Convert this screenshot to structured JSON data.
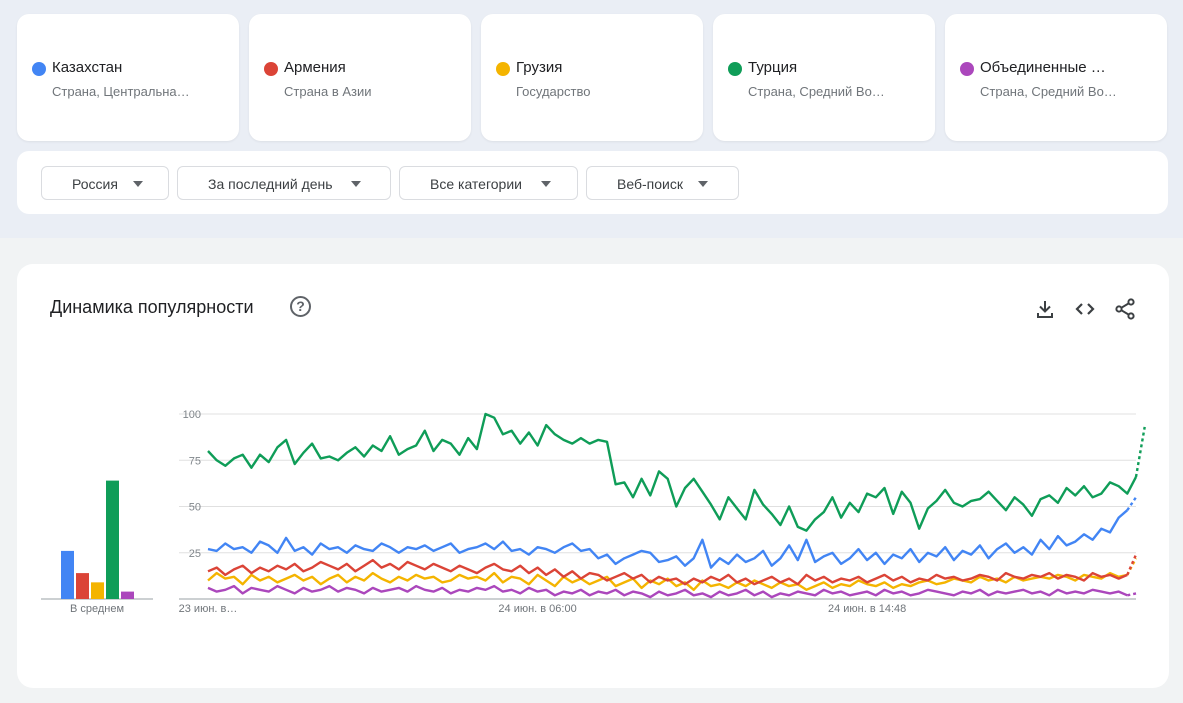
{
  "terms": [
    {
      "name": "Казахстан",
      "description": "Страна, Центральна…",
      "color": "#4285f4"
    },
    {
      "name": "Армения",
      "description": "Страна в Азии",
      "color": "#db4437"
    },
    {
      "name": "Грузия",
      "description": "Государство",
      "color": "#f4b400"
    },
    {
      "name": "Турция",
      "description": "Страна, Средний Во…",
      "color": "#0f9d58"
    },
    {
      "name": "Объединенные …",
      "description": "Страна, Средний Во…",
      "color": "#ab47bc"
    }
  ],
  "filters": {
    "region": "Россия",
    "period": "За последний день",
    "category": "Все категории",
    "search_type": "Веб-поиск"
  },
  "chart": {
    "title": "Динамика популярности",
    "help_glyph": "?",
    "tools": [
      "download-icon",
      "embed-icon",
      "share-icon"
    ]
  },
  "chart_data": {
    "type": "line",
    "title": "Динамика популярности",
    "ylim": [
      0,
      100
    ],
    "yticks": [
      100,
      75,
      50,
      25
    ],
    "grid": true,
    "legend": "top cards",
    "x_tick_labels": [
      "23 июн. в…",
      "24 июн. в 06:00",
      "24 июн. в 14:48"
    ],
    "x_tick_positions": [
      0,
      38,
      76
    ],
    "x_count": 108,
    "last_point_partial": true,
    "averages_label": "В среднем",
    "averages": [
      {
        "name": "Казахстан",
        "value": 26,
        "color": "#4285f4"
      },
      {
        "name": "Армения",
        "value": 14,
        "color": "#db4437"
      },
      {
        "name": "Грузия",
        "value": 9,
        "color": "#f4b400"
      },
      {
        "name": "Турция",
        "value": 64,
        "color": "#0f9d58"
      },
      {
        "name": "Объединенные …",
        "value": 4,
        "color": "#ab47bc"
      }
    ],
    "series": [
      {
        "name": "Турция",
        "color": "#0f9d58",
        "values": [
          80,
          75,
          72,
          76,
          78,
          71,
          78,
          74,
          82,
          86,
          73,
          79,
          84,
          76,
          77,
          75,
          79,
          82,
          77,
          83,
          80,
          88,
          78,
          81,
          83,
          91,
          80,
          86,
          84,
          78,
          87,
          81,
          100,
          98,
          89,
          91,
          84,
          90,
          83,
          94,
          89,
          86,
          84,
          87,
          84,
          86,
          85,
          62,
          63,
          55,
          65,
          56,
          69,
          65,
          50,
          60,
          65,
          58,
          51,
          43,
          55,
          49,
          43,
          59,
          51,
          46,
          40,
          50,
          39,
          37,
          43,
          47,
          55,
          44,
          52,
          47,
          57,
          55,
          60,
          46,
          58,
          52,
          38,
          49,
          53,
          59,
          52,
          50,
          53,
          54,
          58,
          53,
          48,
          55,
          51,
          45,
          54,
          56,
          52,
          60,
          56,
          61,
          55,
          57,
          63,
          61,
          57,
          66,
          93
        ]
      },
      {
        "name": "Казахстан",
        "color": "#4285f4",
        "values": [
          27,
          26,
          30,
          27,
          28,
          25,
          31,
          29,
          25,
          33,
          26,
          28,
          24,
          30,
          27,
          28,
          25,
          29,
          27,
          26,
          30,
          28,
          25,
          28,
          27,
          29,
          26,
          28,
          30,
          25,
          27,
          28,
          30,
          27,
          31,
          26,
          27,
          24,
          28,
          27,
          25,
          28,
          30,
          26,
          27,
          22,
          24,
          19,
          22,
          24,
          26,
          25,
          20,
          21,
          23,
          18,
          22,
          32,
          17,
          22,
          19,
          24,
          20,
          22,
          26,
          18,
          22,
          29,
          21,
          32,
          20,
          23,
          25,
          19,
          22,
          27,
          21,
          25,
          19,
          24,
          22,
          27,
          20,
          25,
          23,
          28,
          21,
          26,
          24,
          29,
          22,
          27,
          30,
          25,
          28,
          24,
          32,
          27,
          34,
          29,
          31,
          35,
          32,
          38,
          36,
          44,
          48,
          55
        ]
      },
      {
        "name": "Армения",
        "color": "#db4437",
        "values": [
          15,
          17,
          13,
          16,
          18,
          14,
          17,
          15,
          18,
          16,
          19,
          15,
          17,
          20,
          18,
          16,
          19,
          15,
          18,
          21,
          17,
          19,
          16,
          20,
          18,
          16,
          19,
          17,
          15,
          18,
          16,
          14,
          17,
          19,
          16,
          15,
          18,
          14,
          17,
          13,
          16,
          12,
          15,
          11,
          14,
          13,
          10,
          12,
          14,
          11,
          13,
          9,
          12,
          10,
          11,
          8,
          11,
          9,
          12,
          10,
          13,
          9,
          11,
          8,
          10,
          12,
          9,
          11,
          8,
          13,
          10,
          12,
          9,
          11,
          10,
          12,
          9,
          11,
          13,
          10,
          12,
          9,
          11,
          10,
          13,
          11,
          12,
          10,
          11,
          13,
          12,
          10,
          14,
          12,
          11,
          13,
          12,
          14,
          11,
          13,
          12,
          10,
          14,
          12,
          13,
          11,
          13,
          24
        ]
      },
      {
        "name": "Грузия",
        "color": "#f4b400",
        "values": [
          10,
          14,
          11,
          12,
          8,
          13,
          10,
          12,
          9,
          11,
          13,
          10,
          12,
          8,
          11,
          13,
          9,
          12,
          10,
          14,
          11,
          9,
          12,
          10,
          13,
          11,
          12,
          9,
          10,
          13,
          11,
          12,
          10,
          14,
          9,
          12,
          11,
          8,
          13,
          10,
          7,
          12,
          9,
          11,
          8,
          10,
          12,
          7,
          9,
          11,
          6,
          10,
          8,
          11,
          7,
          9,
          5,
          10,
          7,
          8,
          6,
          9,
          7,
          10,
          8,
          6,
          9,
          7,
          8,
          5,
          7,
          9,
          6,
          8,
          7,
          10,
          8,
          7,
          9,
          6,
          8,
          7,
          9,
          10,
          8,
          9,
          11,
          10,
          9,
          12,
          10,
          11,
          9,
          12,
          10,
          11,
          12,
          11,
          13,
          12,
          10,
          13,
          12,
          11,
          14,
          12,
          13,
          22
        ]
      },
      {
        "name": "Объединенные …",
        "color": "#ab47bc",
        "values": [
          6,
          4,
          5,
          7,
          3,
          6,
          5,
          4,
          7,
          5,
          3,
          6,
          4,
          5,
          7,
          4,
          6,
          5,
          3,
          6,
          4,
          5,
          6,
          4,
          7,
          5,
          4,
          6,
          3,
          5,
          4,
          6,
          5,
          7,
          4,
          5,
          3,
          6,
          4,
          5,
          2,
          4,
          3,
          5,
          2,
          4,
          3,
          5,
          2,
          4,
          3,
          1,
          4,
          2,
          3,
          5,
          2,
          3,
          1,
          4,
          2,
          3,
          5,
          2,
          4,
          1,
          3,
          2,
          4,
          3,
          2,
          5,
          3,
          4,
          2,
          3,
          4,
          2,
          5,
          3,
          4,
          2,
          3,
          5,
          4,
          3,
          2,
          4,
          3,
          5,
          2,
          4,
          3,
          4,
          5,
          3,
          4,
          2,
          5,
          3,
          4,
          3,
          5,
          4,
          3,
          4,
          2,
          3
        ]
      }
    ]
  }
}
